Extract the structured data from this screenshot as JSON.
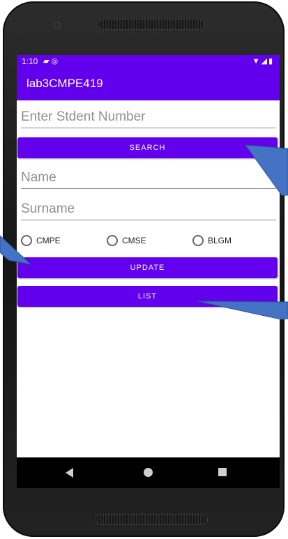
{
  "status_bar": {
    "time": "1:10",
    "left_icons": [
      "sim-card-icon",
      "at-sign-icon"
    ],
    "right_icons": [
      "wifi-icon",
      "signal-icon",
      "battery-icon"
    ]
  },
  "app_bar": {
    "title": "lab3CMPE419"
  },
  "form": {
    "student_number_placeholder": "Enter Stdent Number",
    "search_label": "SEARCH",
    "name_placeholder": "Name",
    "surname_placeholder": "Surname",
    "departments": [
      {
        "label": "CMPE",
        "selected": false
      },
      {
        "label": "CMSE",
        "selected": false
      },
      {
        "label": "BLGM",
        "selected": false
      }
    ],
    "update_label": "UPDATE",
    "list_label": "LIST"
  },
  "nav_bar": {
    "icons": [
      "back-icon",
      "home-icon",
      "recents-icon"
    ]
  },
  "colors": {
    "primary": "#6200ee",
    "callout": "#4472c4"
  }
}
